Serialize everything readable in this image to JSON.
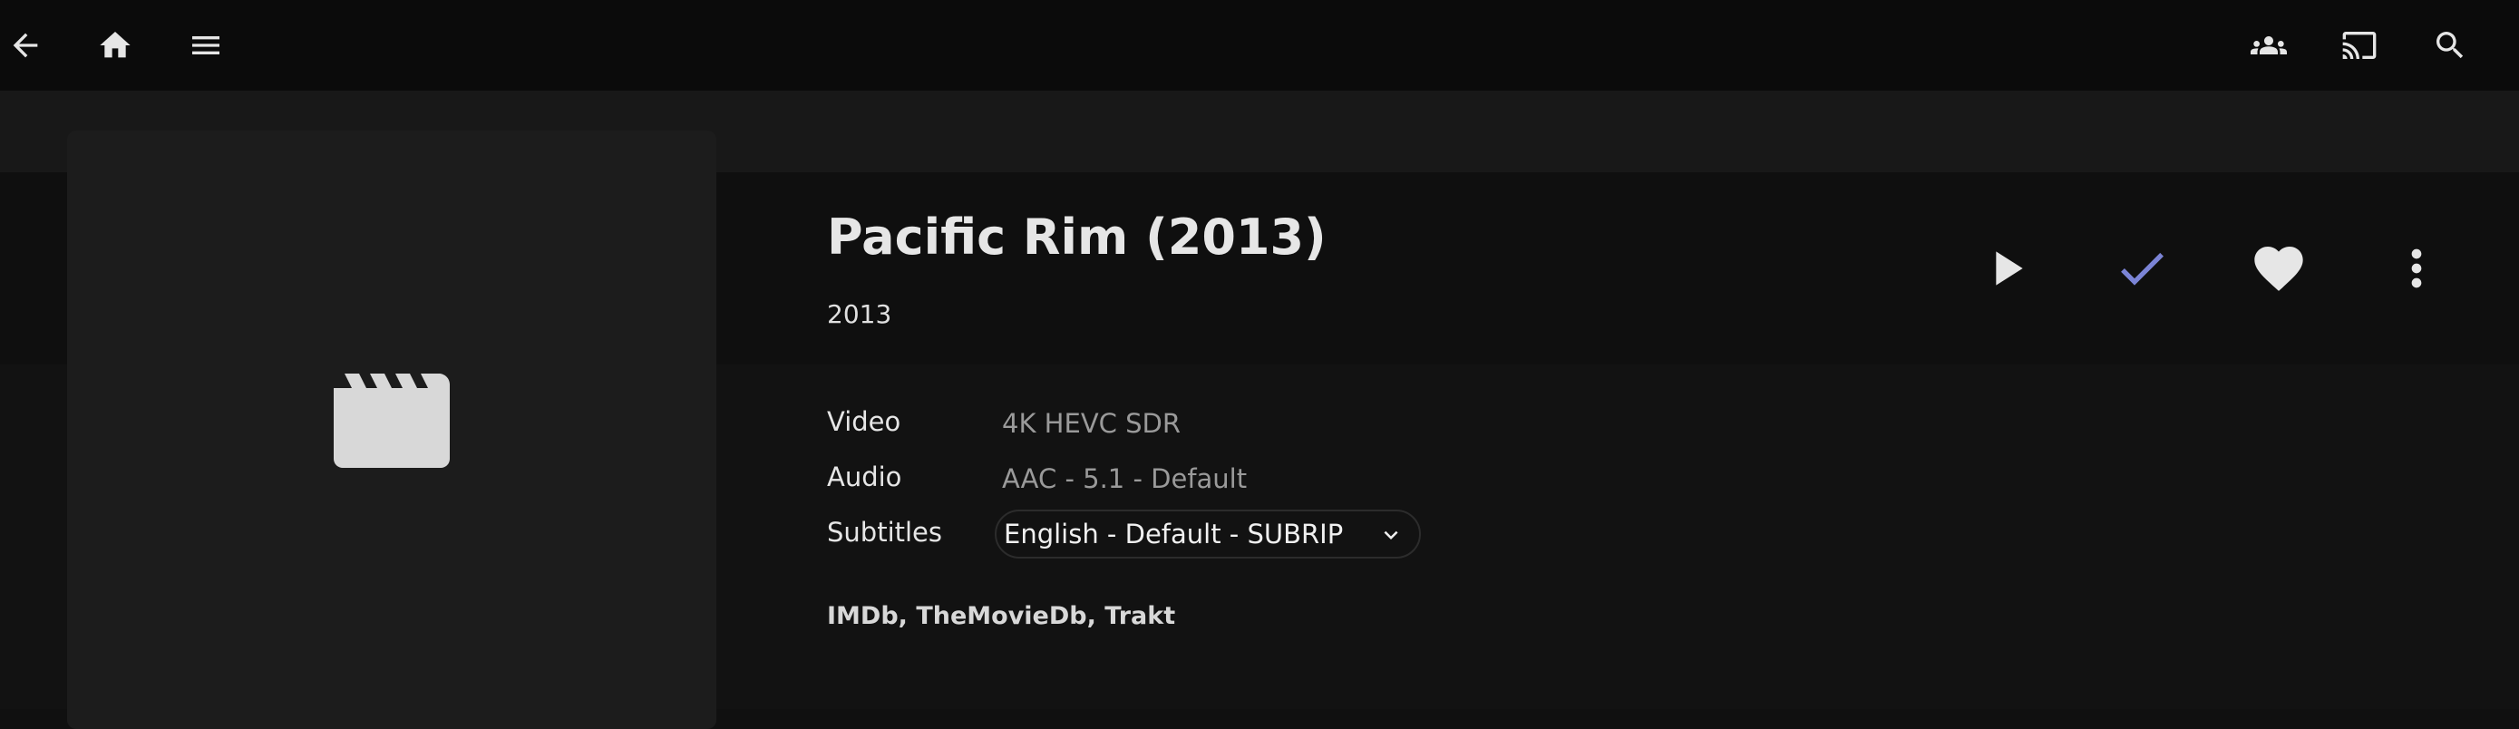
{
  "header": {
    "icons": {
      "back": "arrow-back-icon",
      "home": "home-icon",
      "menu": "menu-icon",
      "users": "people-icon",
      "cast": "cast-icon",
      "search": "search-icon"
    }
  },
  "poster": {
    "icon": "movie-clapperboard-icon"
  },
  "item": {
    "title": "Pacific Rim (2013)",
    "year": "2013"
  },
  "actions": {
    "play_icon": "play-icon",
    "played_icon": "checkmark-icon",
    "favorite_icon": "heart-icon",
    "more_icon": "more-vertical-icon",
    "played_color": "#7b84d6"
  },
  "media_info": {
    "video_label": "Video",
    "video_value": "4K HEVC SDR",
    "audio_label": "Audio",
    "audio_value": "AAC - 5.1 - Default",
    "subtitles_label": "Subtitles",
    "subtitles_value": "English - Default - SUBRIP"
  },
  "links": {
    "items": [
      "IMDb",
      "TheMovieDb",
      "Trakt"
    ],
    "separator": ", "
  }
}
